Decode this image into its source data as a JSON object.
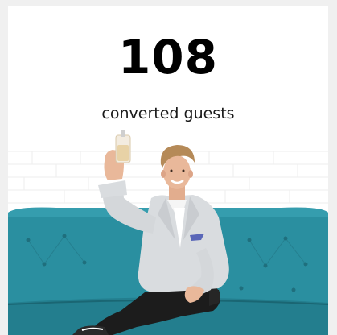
{
  "stat": {
    "number": "108",
    "label": "converted guests"
  },
  "colors": {
    "background": "#ffffff",
    "frame": "#f0f0f0",
    "sofa": "#2a8fa0",
    "sofa_dark": "#1f6f7d",
    "brick": "#f4f4f4",
    "jacket": "#d9dcdf",
    "pants": "#1c1c1c",
    "skin": "#e9b89a",
    "hair": "#b58a58"
  },
  "photo": {
    "icon": "person-toasting-on-sofa-photo"
  }
}
